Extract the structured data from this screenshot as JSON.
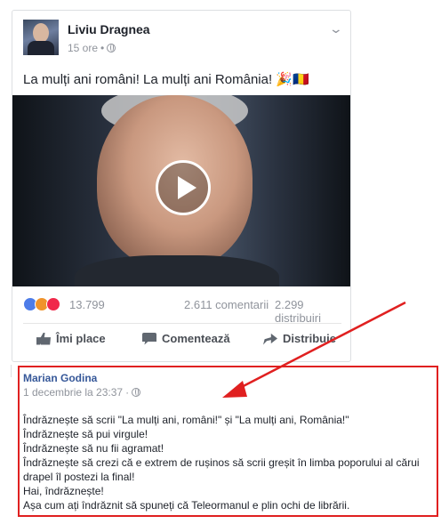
{
  "post": {
    "author": "Liviu Dragnea",
    "time": "15 ore",
    "separator": "•",
    "text": "La mulți ani români! La mulți ani România! 🎉🇷🇴",
    "stats": {
      "reactions_count": "13.799",
      "comments": "2.611 comentarii",
      "shares": "2.299 distribuiri"
    },
    "actions": {
      "like": "Îmi place",
      "comment": "Comentează",
      "share": "Distribuie"
    }
  },
  "comment": {
    "author": "Marian Godina",
    "time": "1 decembrie la 23:37",
    "separator": "·",
    "lines": [
      "Îndrăznește să scrii \"La mulți ani, români!\" și \"La mulți ani, România!\"",
      "Îndrăznește să pui virgule!",
      "Îndrăznește să nu fii agramat!",
      "Îndrăznește să crezi că e extrem de rușinos să scrii greșit în limba poporului al cărui",
      "drapel îl postezi la final!",
      "Hai, îndrăznește!",
      "Așa cum ați îndrăznit să spuneți că Teleormanul e plin ochi de librării."
    ]
  },
  "colors": {
    "highlight_box": "#e02020",
    "link_blue": "#365899",
    "arrow": "#e02020"
  }
}
